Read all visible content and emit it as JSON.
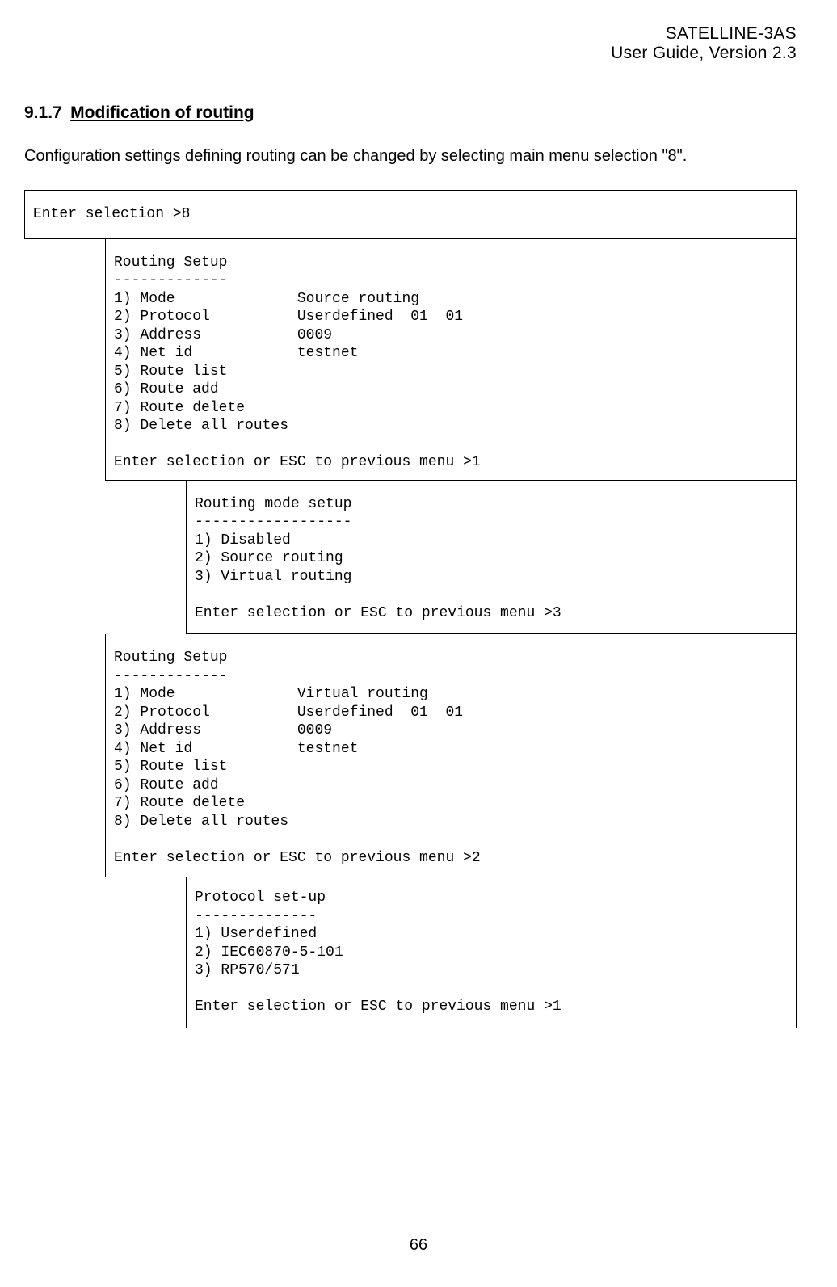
{
  "header": {
    "line1": "SATELLINE-3AS",
    "line2": "User Guide, Version 2.3"
  },
  "section": {
    "num": "9.1.7",
    "title": "Modification of routing"
  },
  "intro": "Configuration settings defining routing can be changed by selecting main menu selection \"8\".",
  "box1": "Enter selection >8",
  "box2": "Routing Setup\n-------------\n1) Mode              Source routing\n2) Protocol          Userdefined  01  01\n3) Address           0009\n4) Net id            testnet\n5) Route list\n6) Route add\n7) Route delete\n8) Delete all routes\n\nEnter selection or ESC to previous menu >1",
  "box3": "Routing mode setup\n------------------\n1) Disabled\n2) Source routing\n3) Virtual routing\n\nEnter selection or ESC to previous menu >3",
  "box4": "Routing Setup\n-------------\n1) Mode              Virtual routing\n2) Protocol          Userdefined  01  01\n3) Address           0009\n4) Net id            testnet\n5) Route list\n6) Route add\n7) Route delete\n8) Delete all routes\n\nEnter selection or ESC to previous menu >2",
  "box5": "Protocol set-up\n--------------\n1) Userdefined\n2) IEC60870-5-101\n3) RP570/571\n\nEnter selection or ESC to previous menu >1",
  "pagenum": "66"
}
